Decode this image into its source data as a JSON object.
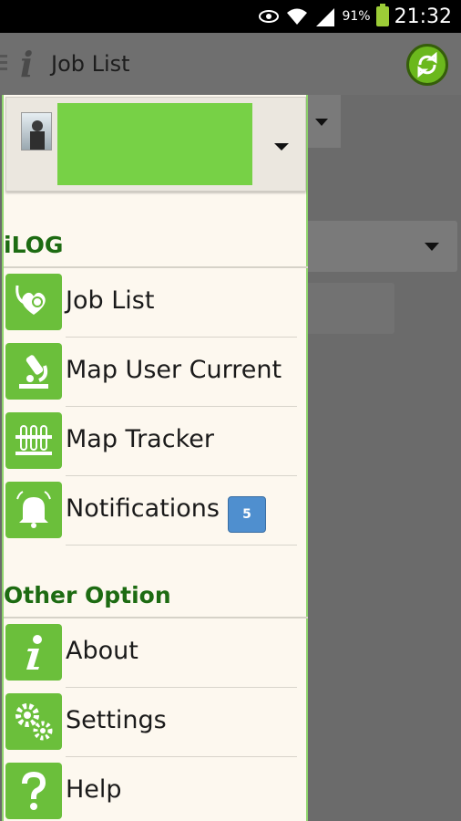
{
  "status_bar": {
    "battery_percent": "91%",
    "time": "21:32",
    "icons": [
      "eye-icon",
      "wifi-icon",
      "signal-icon",
      "battery-charging-icon"
    ]
  },
  "action_bar": {
    "title": "Job List",
    "logo_letter": "i",
    "icons": [
      "menu-icon",
      "refresh-icon"
    ],
    "accent_color": "#6bb81d"
  },
  "drawer": {
    "sections": [
      {
        "header": "iLOG",
        "items": [
          {
            "label": "Job List",
            "icon": "stethoscope-heart-icon"
          },
          {
            "label": "Map User Current",
            "icon": "microscope-icon"
          },
          {
            "label": "Map Tracker",
            "icon": "test-tubes-icon"
          },
          {
            "label": "Notifications",
            "icon": "bell-icon",
            "badge": "5"
          }
        ]
      },
      {
        "header": "Other Option",
        "items": [
          {
            "label": "About",
            "icon": "info-icon"
          },
          {
            "label": "Settings",
            "icon": "gears-icon"
          },
          {
            "label": "Help",
            "icon": "question-icon"
          }
        ]
      }
    ],
    "colors": {
      "header": "#1d6b12",
      "icon_bg": "#6bbf3b",
      "badge": "#4f8fcf",
      "background": "#fdf8ef"
    }
  }
}
